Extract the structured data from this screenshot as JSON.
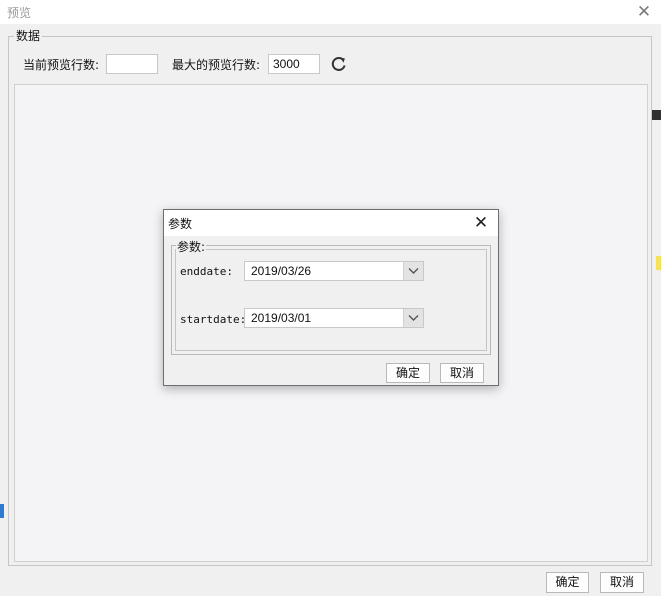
{
  "window": {
    "title": "预览",
    "close_icon": "✕"
  },
  "data_section": {
    "legend": "数据",
    "current_rows_label": "当前预览行数:",
    "current_rows_value": "",
    "max_rows_label": "最大的预览行数:",
    "max_rows_value": "3000",
    "refresh_icon": "refresh-icon"
  },
  "footer": {
    "ok_label": "确定",
    "cancel_label": "取消"
  },
  "params_dialog": {
    "title": "参数",
    "close_icon": "✕",
    "group_legend": "参数:",
    "params": [
      {
        "name": "enddate:",
        "value": "2019/03/26"
      },
      {
        "name": "startdate:",
        "value": "2019/03/01"
      }
    ],
    "ok_label": "确定",
    "cancel_label": "取消"
  },
  "colors": {
    "window_bg": "#f0f0f0",
    "preview_bg": "#f4f4f6",
    "title_text": "#9a9a9a"
  }
}
